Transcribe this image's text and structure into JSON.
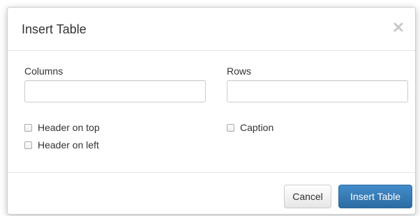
{
  "dialog": {
    "title": "Insert Table",
    "close_icon": "close-icon"
  },
  "form": {
    "columns_label": "Columns",
    "columns_value": "",
    "rows_label": "Rows",
    "rows_value": "",
    "header_on_top_label": "Header on top",
    "header_on_top_checked": false,
    "header_on_left_label": "Header on left",
    "header_on_left_checked": false,
    "caption_label": "Caption",
    "caption_checked": false
  },
  "footer": {
    "cancel_label": "Cancel",
    "insert_label": "Insert Table"
  },
  "colors": {
    "primary": "#428bca",
    "text": "#333333"
  }
}
